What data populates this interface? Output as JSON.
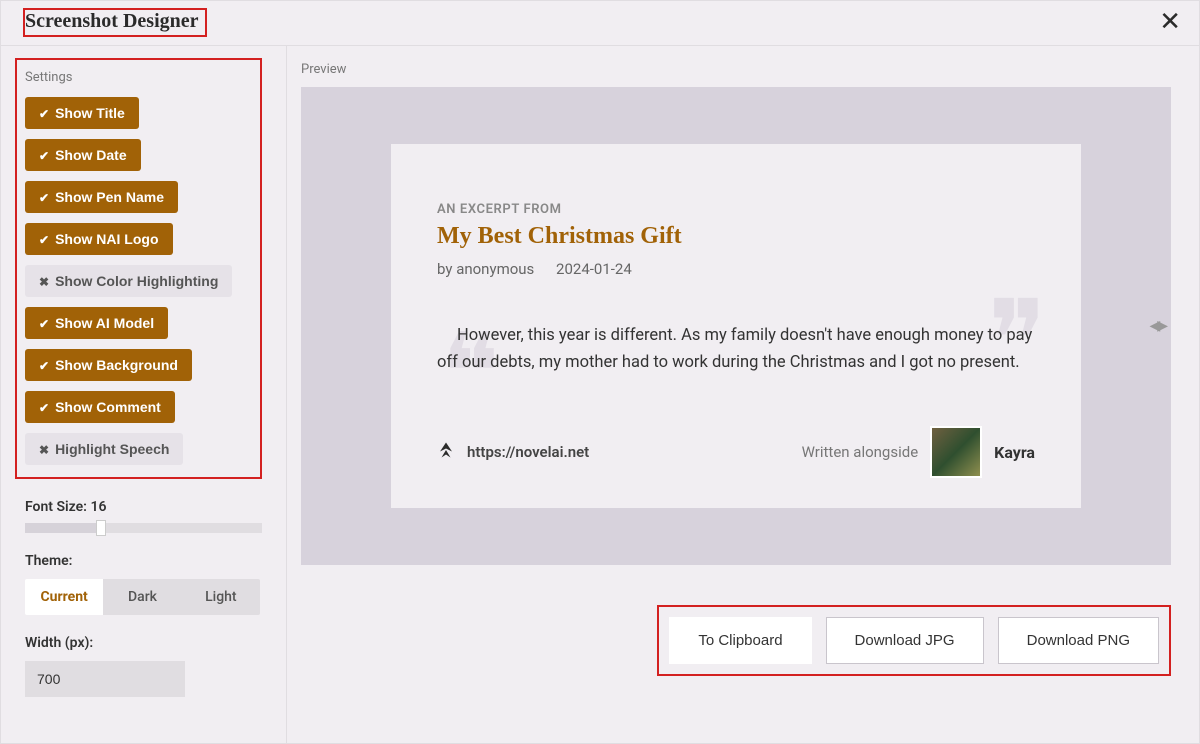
{
  "dialog": {
    "title": "Screenshot Designer",
    "close_glyph": "✕"
  },
  "sidebar": {
    "settings_label": "Settings",
    "toggles": [
      {
        "label": "Show Title",
        "on": true
      },
      {
        "label": "Show Date",
        "on": true
      },
      {
        "label": "Show Pen Name",
        "on": true
      },
      {
        "label": "Show NAI Logo",
        "on": true
      },
      {
        "label": "Show Color Highlighting",
        "on": false
      },
      {
        "label": "Show AI Model",
        "on": true
      },
      {
        "label": "Show Background",
        "on": true
      },
      {
        "label": "Show Comment",
        "on": true
      },
      {
        "label": "Highlight Speech",
        "on": false
      }
    ],
    "font_size_label": "Font Size:",
    "font_size_value": "16",
    "theme_label": "Theme:",
    "themes": [
      {
        "label": "Current",
        "active": true
      },
      {
        "label": "Dark",
        "active": false
      },
      {
        "label": "Light",
        "active": false
      }
    ],
    "width_label": "Width (px):",
    "width_value": "700"
  },
  "preview": {
    "label": "Preview",
    "excerpt_label": "AN EXCERPT FROM",
    "story_title": "My Best Christmas Gift",
    "by_prefix": "by",
    "author": "anonymous",
    "date": "2024-01-24",
    "body_text": "However, this year is different. As my family doesn't have enough money to pay off our debts, my mother had to work during the Christmas and I got no present.",
    "site_url": "https://novelai.net",
    "alongside_text": "Written alongside",
    "model_name": "Kayra"
  },
  "actions": {
    "to_clipboard": "To Clipboard",
    "download_jpg": "Download JPG",
    "download_png": "Download PNG"
  }
}
